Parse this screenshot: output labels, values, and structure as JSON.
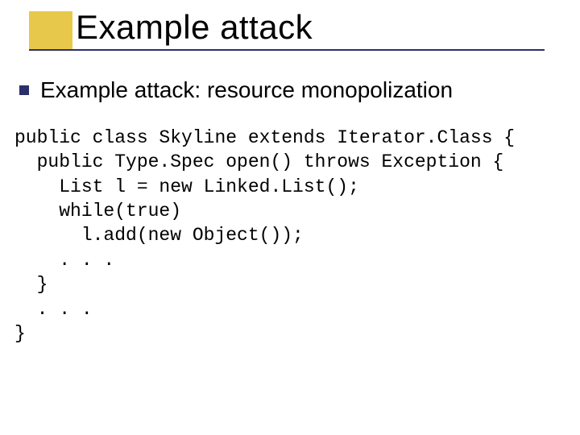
{
  "title": "Example attack",
  "bullet": {
    "text": "Example attack: resource monopolization"
  },
  "code": {
    "line1": "public class Skyline extends Iterator.Class {",
    "line2": "  public Type.Spec open() throws Exception {",
    "line3": "    List l = new Linked.List();",
    "line4": "    while(true)",
    "line5": "      l.add(new Object());",
    "line6": "    . . .",
    "line7": "  }",
    "line8": "  . . .",
    "line9": "}"
  }
}
